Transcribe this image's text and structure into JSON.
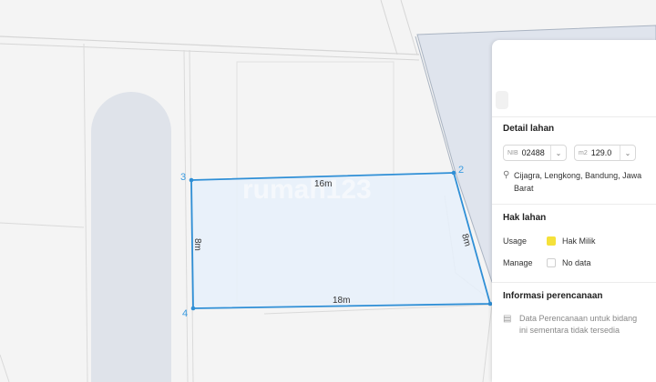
{
  "map": {
    "watermark": "rumah123",
    "vertices": [
      "2",
      "3",
      "4"
    ],
    "edges": [
      "16m",
      "8m",
      "18m",
      "8m"
    ]
  },
  "panel": {
    "detail_title": "Detail lahan",
    "nib_prefix": "NIB",
    "nib_value": "02488",
    "area_prefix": "m2",
    "area_value": "129.0",
    "address": "Cijagra, Lengkong, Bandung, Jawa Barat",
    "rights_title": "Hak lahan",
    "usage_label": "Usage",
    "usage_value": "Hak Milik",
    "usage_color": "#f5e13a",
    "manage_label": "Manage",
    "manage_value": "No data",
    "planning_title": "Informasi perencanaan",
    "planning_text": "Data Perencanaan untuk bidang ini sementara tidak tersedia"
  },
  "colors": {
    "parcel_stroke": "#2f8fd6",
    "parcel_fill": "#e6f0fa"
  }
}
